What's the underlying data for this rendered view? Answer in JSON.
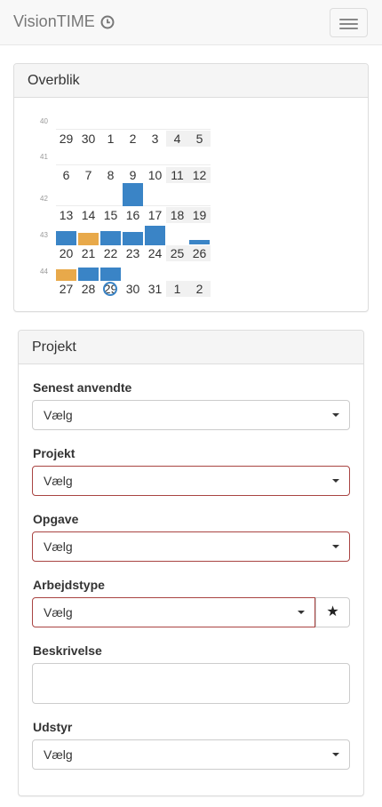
{
  "navbar": {
    "brand": "VisionTIME",
    "brand_icon": "clock-icon",
    "menu_icon": "hamburger-menu-icon"
  },
  "overview": {
    "title": "Overblik",
    "colors": {
      "blue": "#3a84c6",
      "orange": "#e8a94a",
      "today": "#3a84c6"
    },
    "weeks": [
      {
        "week": "40",
        "days": [
          "29",
          "30",
          "1",
          "2",
          "3",
          "4",
          "5"
        ]
      },
      {
        "week": "41",
        "days": [
          "6",
          "7",
          "8",
          "9",
          "10",
          "11",
          "12"
        ]
      },
      {
        "week": "42",
        "days": [
          "13",
          "14",
          "15",
          "16",
          "17",
          "18",
          "19"
        ]
      },
      {
        "week": "43",
        "days": [
          "20",
          "21",
          "22",
          "23",
          "24",
          "25",
          "26"
        ]
      },
      {
        "week": "44",
        "days": [
          "27",
          "28",
          "29",
          "30",
          "31",
          "1",
          "2"
        ]
      }
    ],
    "today": "29"
  },
  "project": {
    "title": "Projekt",
    "fields": {
      "recent": {
        "label": "Senest anvendte",
        "value": "Vælg"
      },
      "project": {
        "label": "Projekt",
        "value": "Vælg"
      },
      "task": {
        "label": "Opgave",
        "value": "Vælg"
      },
      "worktype": {
        "label": "Arbejdstype",
        "value": "Vælg",
        "star": "★"
      },
      "description": {
        "label": "Beskrivelse",
        "value": ""
      },
      "equipment": {
        "label": "Udstyr",
        "value": "Vælg"
      }
    }
  }
}
